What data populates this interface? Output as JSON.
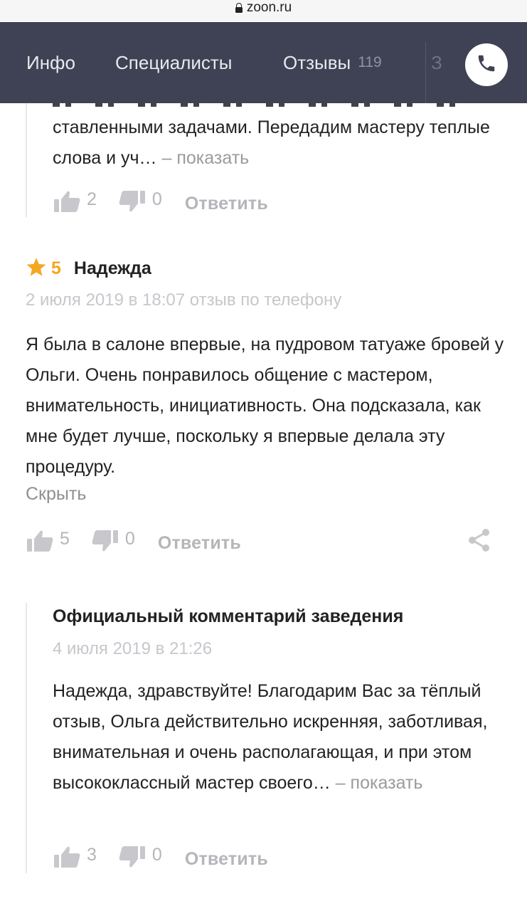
{
  "browser": {
    "url": "zoon.ru"
  },
  "nav": {
    "tabs": [
      {
        "label": "Инфо"
      },
      {
        "label": "Специалисты"
      },
      {
        "label": "Отзывы",
        "count": "119"
      },
      {
        "label": "З"
      }
    ],
    "phone_icon": "phone-icon",
    "colors": {
      "background": "#3f4254",
      "accent": "#f5a623"
    }
  },
  "prev_reply": {
    "text": "ставленными задачами. Передадим мастеру теплые слова и уч…",
    "show_more": "– показать",
    "likes": "2",
    "dislikes": "0",
    "reply_label": "Ответить"
  },
  "review": {
    "rating": "5",
    "author": "Надежда",
    "meta": "2 июля 2019 в 18:07 отзыв по телефону",
    "text": "Я была в салоне впервые, на пудровом татуаже бровей у Ольги. Очень понравилось общение с мастером, внимательность, инициативность. Она подсказала, как мне будет лучше, поскольку я впервые делала эту процедуру.",
    "hide_label": "Скрыть",
    "likes": "5",
    "dislikes": "0",
    "reply_label": "Ответить"
  },
  "official_reply": {
    "title": "Официальный комментарий заведения",
    "date": "4 июля 2019 в 21:26",
    "text": "Надежда, здравствуйте! Благодарим Вас за тёплый отзыв, Ольга действительно ис­кренняя, заботливая, внимательная и очень располагающая, и при этом высококлассный мастер своего…",
    "show_more": "– показать",
    "likes": "3",
    "dislikes": "0",
    "reply_label": "Ответить"
  }
}
